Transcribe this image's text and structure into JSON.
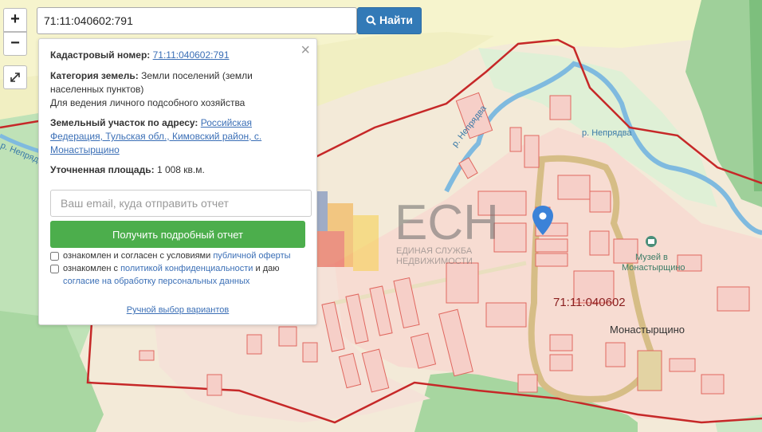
{
  "search": {
    "value": "71:11:040602:791",
    "button_label": "Найти"
  },
  "zoom": {
    "in_label": "+",
    "out_label": "−"
  },
  "panel": {
    "close_label": "×",
    "cadastral_label": "Кадастровый номер:",
    "cadastral_value": "71:11:040602:791",
    "category_label": "Категория земель:",
    "category_value_1": "Земли поселений (земли",
    "category_value_2": "населенных пунктов)",
    "category_value_3": "Для ведения личного подсобного хозяйства",
    "address_label": "Земельный участок по адресу:",
    "address_1": "Российская",
    "address_2": "Федерация, Тульская обл., Кимовский район, с.",
    "address_3": "Монастырщино",
    "area_label": "Уточненная площадь:",
    "area_value": "1 008 кв.м.",
    "email_placeholder": "Ваш email, куда отправить отчет",
    "report_button": "Получить подробный отчет",
    "consent1_text": "ознакомлен и согласен с условиями",
    "consent1_link": "публичной оферты",
    "consent2_text": "ознакомлен с",
    "consent2_link": "политикой конфиденциальности",
    "consent2_tail": "и даю",
    "consent2_link2": "согласие на обработку персональных данных",
    "manual_link": "Ручной выбор вариантов"
  },
  "map_labels": {
    "river_1": "р. Непрядва",
    "river_2": "р. Непрядва",
    "river_3": "р. Непрядва",
    "quarter": "71:11:040602",
    "village": "Монастырщино",
    "museum_1": "Музей в",
    "museum_2": "Монастырщино"
  },
  "watermark": {
    "letters": "ЕСН",
    "line1": "ЕДИНАЯ СЛУЖБА",
    "line2": "НЕДВИЖИМОСТИ"
  },
  "colors": {
    "accent_blue": "#337ab7",
    "report_green": "#4cae4c",
    "forest": "#8cc58c",
    "field": "#f5f2c9",
    "parcel_fill": "#f6cfc8",
    "parcel_border": "#e0675f",
    "boundary": "#c62828",
    "river": "#7fbadf",
    "road": "#d9c08c"
  }
}
